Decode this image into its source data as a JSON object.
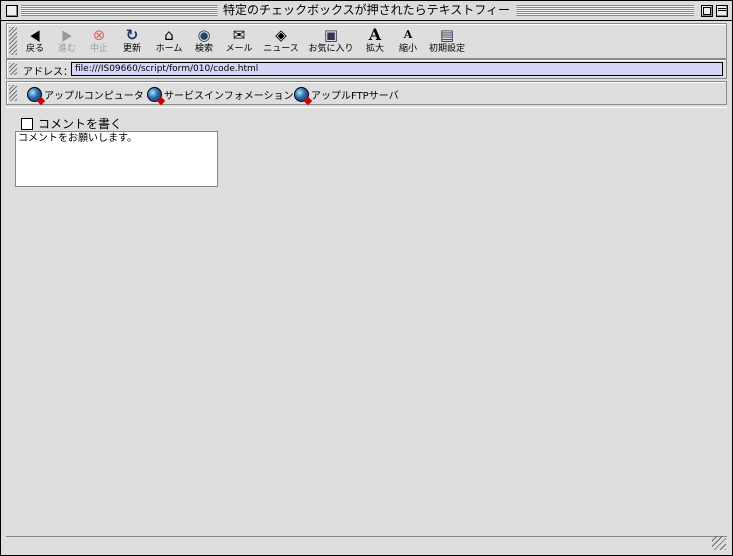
{
  "window": {
    "title": "特定のチェックボックスが押されたらテキストフィー"
  },
  "toolbar": {
    "buttons": [
      {
        "label": "戻る",
        "icon": "back-arrow-icon",
        "glyph": "◆",
        "enabled": true
      },
      {
        "label": "進む",
        "icon": "forward-arrow-icon",
        "glyph": "◆",
        "enabled": false
      },
      {
        "label": "中止",
        "icon": "stop-icon",
        "glyph": "⊗",
        "enabled": false
      },
      {
        "label": "更新",
        "icon": "refresh-icon",
        "glyph": "C",
        "enabled": true
      },
      {
        "label": "ホーム",
        "icon": "home-icon",
        "glyph": "⌂",
        "enabled": true
      },
      {
        "label": "検索",
        "icon": "search-icon",
        "glyph": "◉",
        "enabled": true
      },
      {
        "label": "メール",
        "icon": "mail-icon",
        "glyph": "✉",
        "enabled": true
      },
      {
        "label": "ニュース",
        "icon": "news-icon",
        "glyph": "◈",
        "enabled": true
      },
      {
        "label": "お気に入り",
        "icon": "favorites-icon",
        "glyph": "▣",
        "enabled": true
      },
      {
        "label": "拡大",
        "icon": "text-larger-icon",
        "glyph": "A",
        "enabled": true
      },
      {
        "label": "縮小",
        "icon": "text-smaller-icon",
        "glyph": "A",
        "enabled": true
      },
      {
        "label": "初期設定",
        "icon": "preferences-icon",
        "glyph": "▤",
        "enabled": true
      }
    ]
  },
  "address": {
    "label": "アドレス：",
    "value": "file:///IS09660/script/form/010/code.html"
  },
  "favorites": [
    {
      "label": "アップルコンピュータ"
    },
    {
      "label": "サービスインフォメーション"
    },
    {
      "label": "アップルFTPサーバ"
    }
  ],
  "form": {
    "checkbox_label": "コメントを書く",
    "checkbox_checked": false,
    "textarea_value": "コメントをお願いします。"
  }
}
